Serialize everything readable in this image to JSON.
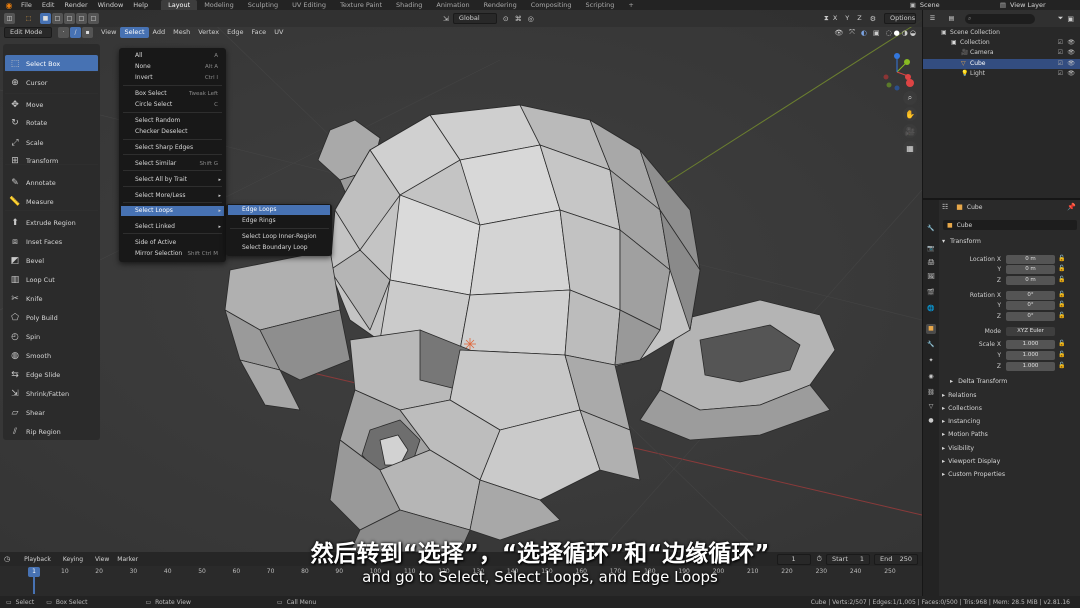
{
  "topbar": {
    "menus": [
      "File",
      "Edit",
      "Render",
      "Window",
      "Help"
    ],
    "workspaces": [
      "Layout",
      "Modeling",
      "Sculpting",
      "UV Editing",
      "Texture Paint",
      "Shading",
      "Animation",
      "Rendering",
      "Compositing",
      "Scripting"
    ],
    "active_workspace": "Layout",
    "scene": "Scene",
    "view_layer": "View Layer"
  },
  "viewport_header": {
    "mode": "Edit Mode",
    "menus": [
      "View",
      "Select",
      "Add",
      "Mesh",
      "Vertex",
      "Edge",
      "Face",
      "UV"
    ],
    "active_menu": "Select",
    "transform_orientation": "Global",
    "axes": [
      "X",
      "Y",
      "Z"
    ],
    "options": "Options"
  },
  "tools": [
    {
      "label": "Select Box",
      "icon": "select-box-icon",
      "active": true
    },
    {
      "label": "Cursor",
      "icon": "cursor-icon"
    },
    {
      "label": "Move",
      "icon": "move-icon"
    },
    {
      "label": "Rotate",
      "icon": "rotate-icon"
    },
    {
      "label": "Scale",
      "icon": "scale-icon"
    },
    {
      "label": "Transform",
      "icon": "transform-icon"
    },
    {
      "label": "Annotate",
      "icon": "annotate-icon"
    },
    {
      "label": "Measure",
      "icon": "measure-icon"
    },
    {
      "label": "Extrude Region",
      "icon": "extrude-icon"
    },
    {
      "label": "Inset Faces",
      "icon": "inset-icon"
    },
    {
      "label": "Bevel",
      "icon": "bevel-icon"
    },
    {
      "label": "Loop Cut",
      "icon": "loop-cut-icon"
    },
    {
      "label": "Knife",
      "icon": "knife-icon"
    },
    {
      "label": "Poly Build",
      "icon": "poly-build-icon"
    },
    {
      "label": "Spin",
      "icon": "spin-icon"
    },
    {
      "label": "Smooth",
      "icon": "smooth-icon"
    },
    {
      "label": "Edge Slide",
      "icon": "edge-slide-icon"
    },
    {
      "label": "Shrink/Fatten",
      "icon": "shrink-icon"
    },
    {
      "label": "Shear",
      "icon": "shear-icon"
    },
    {
      "label": "Rip Region",
      "icon": "rip-icon"
    }
  ],
  "select_menu": {
    "items": [
      {
        "label": "All",
        "shortcut": "A"
      },
      {
        "label": "None",
        "shortcut": "Alt A"
      },
      {
        "label": "Invert",
        "shortcut": "Ctrl I"
      },
      {
        "label": "Box Select",
        "shortcut": "Tweak Left"
      },
      {
        "label": "Circle Select",
        "shortcut": "C"
      },
      {
        "label": "Select Random",
        "shortcut": ""
      },
      {
        "label": "Checker Deselect",
        "shortcut": ""
      },
      {
        "label": "Select Sharp Edges",
        "shortcut": ""
      },
      {
        "label": "Select Similar",
        "shortcut": "Shift G"
      },
      {
        "label": "Select All by Trait",
        "shortcut": ""
      },
      {
        "label": "Select More/Less",
        "shortcut": ""
      },
      {
        "label": "Select Loops",
        "shortcut": ""
      },
      {
        "label": "Select Linked",
        "shortcut": ""
      },
      {
        "label": "Side of Active",
        "shortcut": ""
      },
      {
        "label": "Mirror Selection",
        "shortcut": "Shift Ctrl M"
      }
    ]
  },
  "loops_submenu": {
    "items": [
      "Edge Loops",
      "Edge Rings",
      "Select Loop Inner-Region",
      "Select Boundary Loop"
    ]
  },
  "timeline": {
    "menus": [
      "Playback",
      "Keying",
      "View",
      "Marker"
    ],
    "current_frame": "1",
    "start_label": "Start",
    "start": "1",
    "end_label": "End",
    "end": "250",
    "ticks": [
      "10",
      "20",
      "30",
      "40",
      "50",
      "60",
      "70",
      "80",
      "90",
      "100",
      "110",
      "120",
      "130",
      "140",
      "150",
      "160",
      "170",
      "180",
      "190",
      "200",
      "210",
      "220",
      "230",
      "240",
      "250"
    ]
  },
  "status": {
    "select": "Select",
    "box_select": "Box Select",
    "rotate_view": "Rotate View",
    "call_menu": "Call Menu",
    "stats": "Cube | Verts:2/507 | Edges:1/1,005 | Faces:0/500 | Tris:968 | Mem: 28.5 MiB | v2.81.16"
  },
  "outliner": {
    "search_placeholder": "",
    "rows": [
      {
        "label": "Scene Collection",
        "indent": 0
      },
      {
        "label": "Collection",
        "indent": 1
      },
      {
        "label": "Camera",
        "indent": 2
      },
      {
        "label": "Cube",
        "indent": 2,
        "selected": true
      },
      {
        "label": "Light",
        "indent": 2
      }
    ]
  },
  "properties": {
    "object_name": "Cube",
    "object_field": "Cube",
    "transform_header": "Transform",
    "location_label": "Location X",
    "location": [
      "0 m",
      "0 m",
      "0 m"
    ],
    "rotation_label": "Rotation X",
    "rotation": [
      "0°",
      "0°",
      "0°"
    ],
    "mode_label": "Mode",
    "mode": "XYZ Euler",
    "scale_label": "Scale X",
    "scale": [
      "1.000",
      "1.000",
      "1.000"
    ],
    "axis_y": "Y",
    "axis_z": "Z",
    "delta_transform": "Delta Transform",
    "sections": [
      "Relations",
      "Collections",
      "Instancing",
      "Motion Paths",
      "Visibility",
      "Viewport Display",
      "Custom Properties"
    ]
  },
  "subtitles": {
    "chinese": "然后转到“选择”，“选择循环”和“边缘循环”",
    "english": "and go to Select, Select Loops, and Edge Loops"
  },
  "colors": {
    "accent": "#4772b3",
    "selected_row": "#334d80",
    "viewport_bg": "#3b3b3b",
    "mesh_face": "#bdbdbd"
  }
}
